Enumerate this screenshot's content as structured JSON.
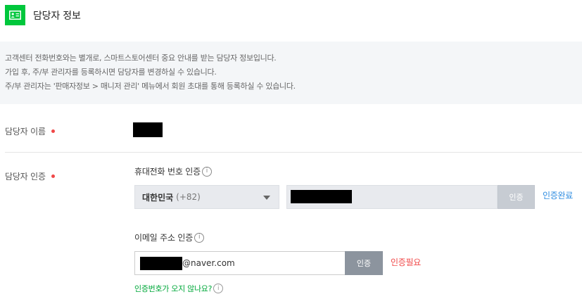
{
  "header": {
    "icon": "id-card-icon",
    "title": "담당자 정보"
  },
  "notice": {
    "lines": [
      "고객센터 전화번호와는 별개로, 스마트스토어센터 중요 안내를 받는 담당자 정보입니다.",
      "가입 후, 주/부 관리자를 등록하시면 담당자를 변경하실 수 있습니다.",
      "주/부 관리자는 '판매자정보 > 매니저 관리' 메뉴에서 회원 초대를 통해 등록하실 수 있습니다."
    ]
  },
  "name_row": {
    "label": "담당자 이름"
  },
  "auth_row": {
    "label": "담당자 인증",
    "phone": {
      "label": "휴대전화 번호 인증",
      "country_name": "대한민국",
      "country_code": "(+82)",
      "button": "인증",
      "status": "인증완료"
    },
    "email": {
      "label": "이메일 주소 인증",
      "domain": "@naver.com",
      "button": "인증",
      "status": "인증필요"
    },
    "help_link": "인증번호가 오지 않나요?"
  },
  "colors": {
    "brand_green": "#00c73c",
    "required_red": "#f04848",
    "done_blue": "#2d8ce0",
    "link_green": "#00a83a"
  }
}
